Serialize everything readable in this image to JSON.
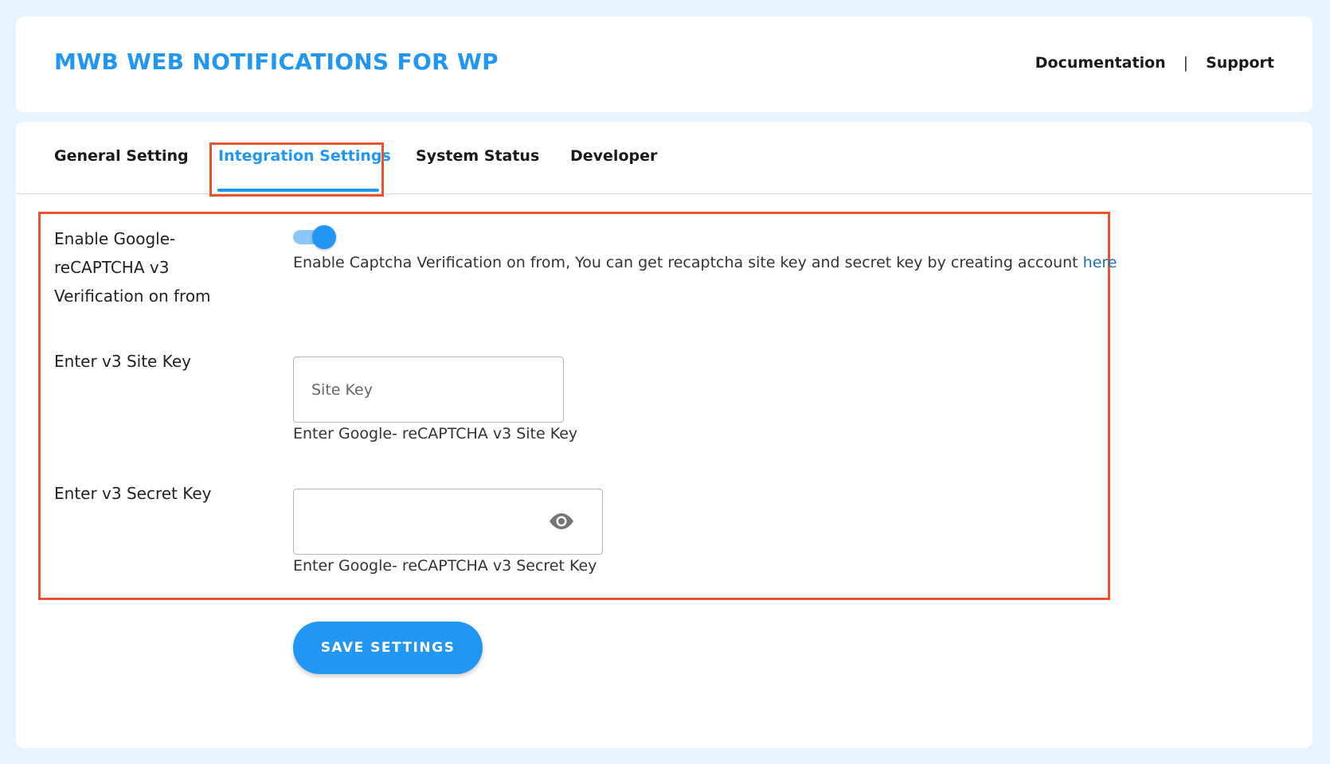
{
  "header": {
    "title": "MWB WEB NOTIFICATIONS FOR WP",
    "links": {
      "documentation": "Documentation",
      "separator": "|",
      "support": "Support"
    }
  },
  "tabs": [
    {
      "label": "General Setting",
      "active": false
    },
    {
      "label": "Integration Settings",
      "active": true
    },
    {
      "label": "System Status",
      "active": false
    },
    {
      "label": "Developer",
      "active": false
    }
  ],
  "settings": {
    "recaptcha_toggle": {
      "label": "Enable Google-reCAPTCHA v3 Verification on from",
      "enabled": true,
      "description": "Enable Captcha Verification on from, You can get recaptcha site key and secret key by creating account ",
      "link_text": "here"
    },
    "site_key": {
      "label": "Enter v3 Site Key",
      "placeholder": "Site Key",
      "value": "",
      "description": "Enter Google- reCAPTCHA v3 Site Key"
    },
    "secret_key": {
      "label": "Enter v3 Secret Key",
      "placeholder": "",
      "value": "",
      "description": "Enter Google- reCAPTCHA v3 Secret Key",
      "icon": "eye-icon"
    }
  },
  "actions": {
    "save_label": "SAVE SETTINGS"
  },
  "colors": {
    "accent": "#2196f3",
    "highlight": "#e8542f",
    "background": "#e8f4fd"
  }
}
